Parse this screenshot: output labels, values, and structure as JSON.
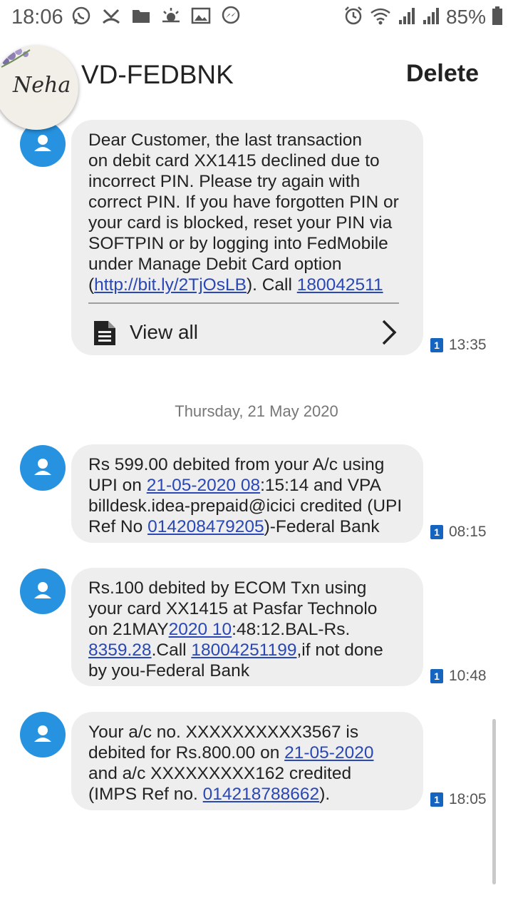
{
  "status_bar": {
    "time": "18:06",
    "battery": "85%",
    "left_icons": [
      "whatsapp-icon",
      "missed-call-icon",
      "folder-icon",
      "weather-icon",
      "gallery-icon",
      "messenger-icon"
    ],
    "right_icons": [
      "alarm-icon",
      "wifi-icon",
      "signal-icon",
      "signal-icon",
      "battery-icon"
    ]
  },
  "header": {
    "contact": "VD-FEDBNK",
    "delete_label": "Delete",
    "profile_text": "Neha"
  },
  "messages": [
    {
      "parts": [
        {
          "t": "Dear Customer, the last transaction\non debit card XX1415 declined due to\nincorrect PIN. Please try again with\ncorrect PIN. If you have forgotten PIN or\nyour card is blocked, reset your PIN via\nSOFTPIN or by logging into FedMobile\nunder Manage Debit Card option\n("
        },
        {
          "t": "http://bit.ly/2TjOsLB",
          "link": true
        },
        {
          "t": "). Call "
        },
        {
          "t": "180042511",
          "link": true
        }
      ],
      "view_all": "View all",
      "time": "13:35",
      "sim": "1"
    },
    {
      "parts": [
        {
          "t": "Rs 599.00 debited from your A/c using\nUPI on "
        },
        {
          "t": "21-05-2020 08",
          "link": true
        },
        {
          "t": ":15:14 and VPA\nbilldesk.idea-prepaid@icici credited (UPI\nRef No "
        },
        {
          "t": "014208479205",
          "link": true
        },
        {
          "t": ")-Federal Bank"
        }
      ],
      "time": "08:15",
      "sim": "1"
    },
    {
      "parts": [
        {
          "t": "Rs.100 debited by ECOM Txn using\nyour card XX1415 at Pasfar Technolo\non 21MAY"
        },
        {
          "t": "2020 10",
          "link": true
        },
        {
          "t": ":48:12.BAL-Rs.\n"
        },
        {
          "t": "8359.28",
          "link": true
        },
        {
          "t": ".Call "
        },
        {
          "t": "18004251199",
          "link": true
        },
        {
          "t": ",if not done\nby you-Federal Bank"
        }
      ],
      "time": "10:48",
      "sim": "1"
    },
    {
      "parts": [
        {
          "t": "Your a/c no. XXXXXXXXXX3567 is\ndebited for Rs.800.00 on "
        },
        {
          "t": "21-05-2020",
          "link": true
        },
        {
          "t": "\nand a/c XXXXXXXXX162 credited\n(IMPS Ref no. "
        },
        {
          "t": "014218788662",
          "link": true
        },
        {
          "t": ")."
        }
      ],
      "time": "18:05",
      "sim": "1"
    }
  ],
  "date_separator": "Thursday, 21 May 2020",
  "colors": {
    "avatar": "#2692e0",
    "bubble": "#eeeeee",
    "link": "#2947b5",
    "sim_badge": "#1565c0"
  }
}
